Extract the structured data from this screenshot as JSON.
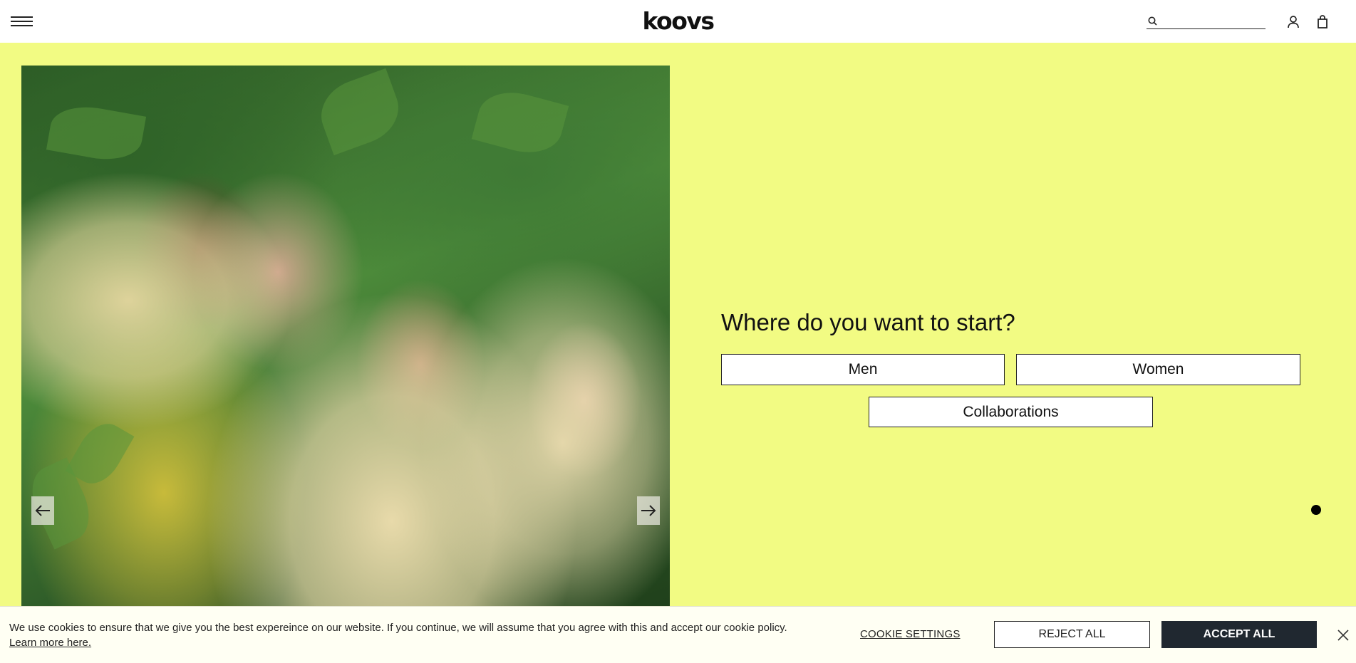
{
  "header": {
    "logo": "koovs",
    "search_placeholder": "",
    "icons": [
      "menu-icon",
      "search-icon",
      "user-icon",
      "bag-icon"
    ]
  },
  "hero": {
    "image_alt": "Four models in pale yellow outfits posing in front of green ferns",
    "prev_icon": "arrow-left-icon",
    "next_icon": "arrow-right-icon"
  },
  "start": {
    "question": "Where do you want to start?",
    "men_label": "Men",
    "women_label": "Women",
    "collab_label": "Collaborations"
  },
  "cookie": {
    "message": "We use cookies to ensure that we give you the best expereince on our website. If you continue, we will assume that you agree with this and accept our cookie policy.",
    "learn_more": "Learn more here.",
    "settings_label": "COOKIE SETTINGS",
    "reject_label": "REJECT ALL",
    "accept_label": "ACCEPT ALL"
  },
  "colors": {
    "background": "#f2fb83",
    "header": "#ffffff",
    "accept_button": "#202830",
    "cookie_banner": "#fffff3"
  }
}
